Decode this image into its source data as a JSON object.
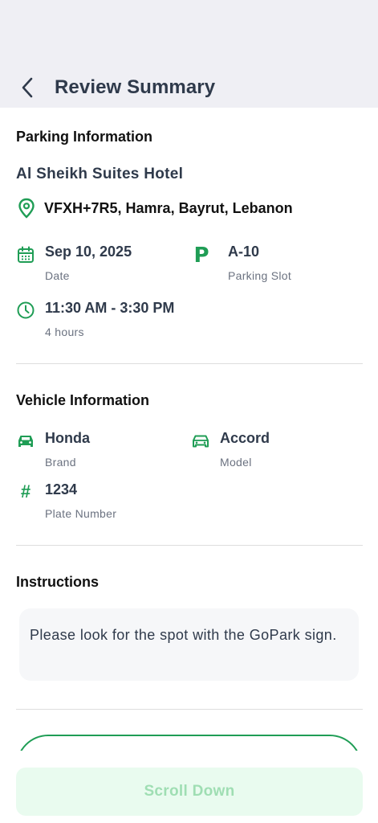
{
  "header": {
    "title": "Review Summary",
    "back_icon": "chevron-left-icon"
  },
  "parking": {
    "section_title": "Parking Information",
    "hotel": "Al Sheikh Suites Hotel",
    "address": "VFXH+7R5, Hamra, Bayrut, Lebanon",
    "date": {
      "value": "Sep 10, 2025",
      "label": "Date"
    },
    "slot": {
      "value": "A-10",
      "label": "Parking Slot"
    },
    "time": {
      "value": "11:30 AM - 3:30 PM",
      "label": "4 hours"
    }
  },
  "vehicle": {
    "section_title": "Vehicle Information",
    "brand": {
      "value": "Honda",
      "label": "Brand"
    },
    "model": {
      "value": "Accord",
      "label": "Model"
    },
    "plate": {
      "value": "1234",
      "label": "Plate Number"
    }
  },
  "instructions": {
    "section_title": "Instructions",
    "text": "Please look for the spot with the GoPark sign."
  },
  "footer": {
    "scroll_label": "Scroll Down"
  },
  "colors": {
    "accent": "#1f9d55",
    "header_bg": "#efeff4",
    "button_bg": "#e9fbef",
    "button_text": "#9fdeb3"
  }
}
